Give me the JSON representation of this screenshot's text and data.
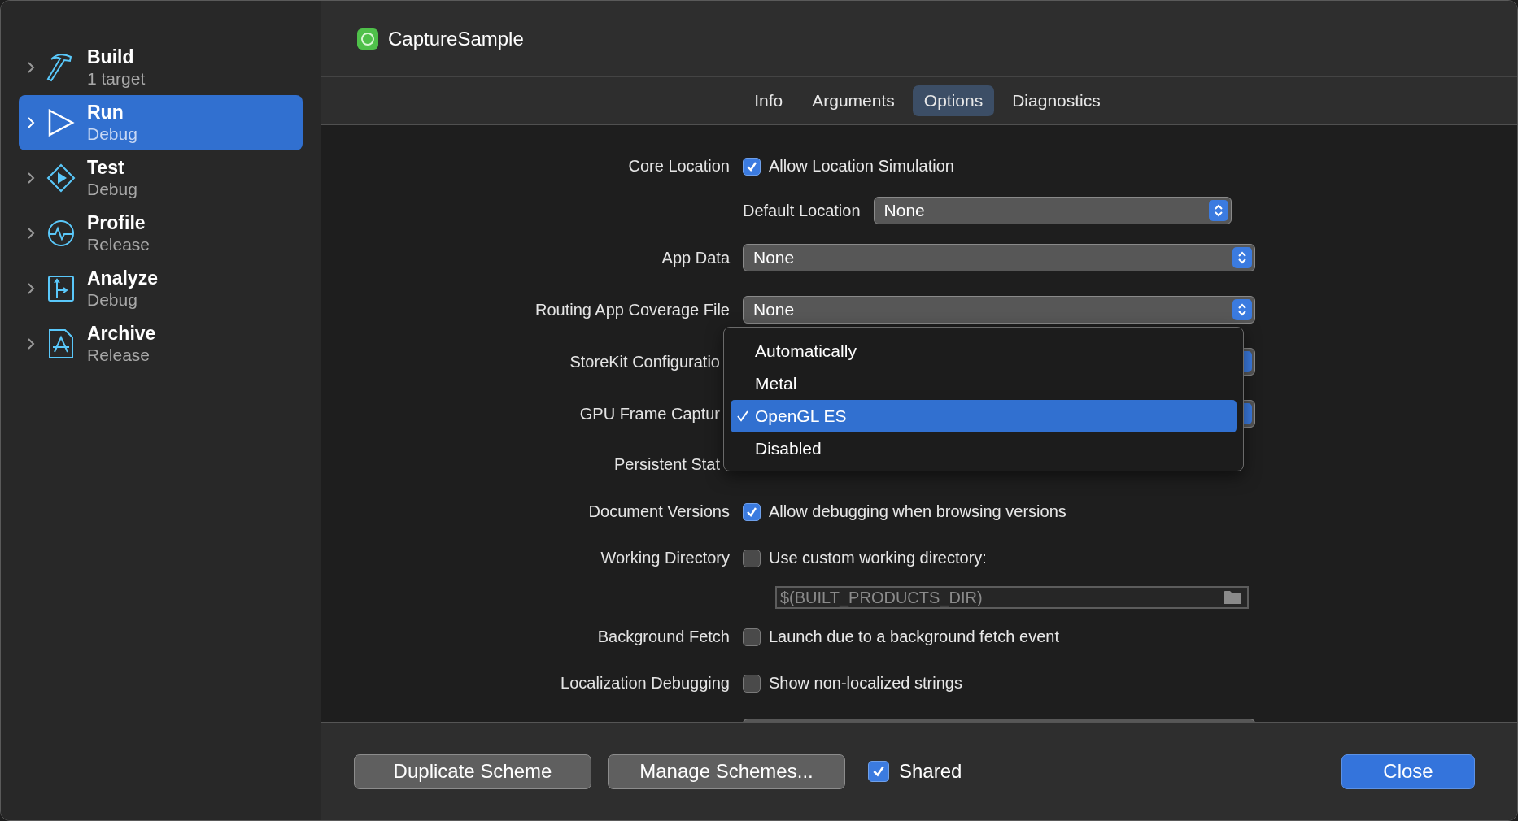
{
  "sidebar": {
    "items": [
      {
        "title": "Build",
        "subtitle": "1 target",
        "selected": false
      },
      {
        "title": "Run",
        "subtitle": "Debug",
        "selected": true
      },
      {
        "title": "Test",
        "subtitle": "Debug",
        "selected": false
      },
      {
        "title": "Profile",
        "subtitle": "Release",
        "selected": false
      },
      {
        "title": "Analyze",
        "subtitle": "Debug",
        "selected": false
      },
      {
        "title": "Archive",
        "subtitle": "Release",
        "selected": false
      }
    ]
  },
  "header": {
    "title": "CaptureSample"
  },
  "tabs": [
    {
      "label": "Info",
      "selected": false
    },
    {
      "label": "Arguments",
      "selected": false
    },
    {
      "label": "Options",
      "selected": true
    },
    {
      "label": "Diagnostics",
      "selected": false
    }
  ],
  "options": [
    {
      "kind": "checkbox",
      "label": "Core Location",
      "text": "Allow Location Simulation",
      "checked": true
    },
    {
      "kind": "sub_popup",
      "sublabel": "Default Location",
      "value": "None"
    },
    {
      "kind": "popup",
      "label": "App Data",
      "value": "None"
    },
    {
      "kind": "popup",
      "label": "Routing App Coverage File",
      "value": "None"
    },
    {
      "kind": "popup",
      "label": "StoreKit Configuratio",
      "covered": true
    },
    {
      "kind": "popup",
      "label": "GPU Frame Captur",
      "covered": true
    },
    {
      "kind": "label",
      "label": "Persistent Stat",
      "covered": true
    },
    {
      "kind": "checkbox",
      "label": "Document Versions",
      "text": "Allow debugging when browsing versions",
      "checked": true
    },
    {
      "kind": "checkbox",
      "label": "Working Directory",
      "text": "Use custom working directory:",
      "checked": false
    },
    {
      "kind": "path",
      "placeholder": "$(BUILT_PRODUCTS_DIR)"
    },
    {
      "kind": "checkbox",
      "label": "Background Fetch",
      "text": "Launch due to a background fetch event",
      "checked": false
    },
    {
      "kind": "checkbox",
      "label": "Localization Debugging",
      "text": "Show non-localized strings",
      "checked": false
    },
    {
      "kind": "popup"
    }
  ],
  "menu": {
    "items": [
      {
        "label": "Automatically",
        "selected": false
      },
      {
        "label": "Metal",
        "selected": false
      },
      {
        "label": "OpenGL ES",
        "selected": true
      },
      {
        "label": "Disabled",
        "selected": false
      }
    ]
  },
  "footer": {
    "buttons": [
      "Duplicate Scheme",
      "Manage Schemes..."
    ],
    "shared": {
      "label": "Shared",
      "checked": true
    },
    "close": "Close"
  }
}
